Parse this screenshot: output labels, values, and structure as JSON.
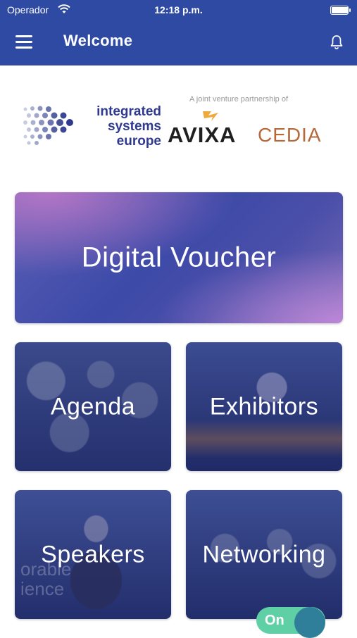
{
  "status_bar": {
    "carrier": "Operador",
    "time": "12:18 p.m.",
    "battery_level": 1.0
  },
  "header": {
    "title": "Welcome",
    "menu_icon": "hamburger-menu-icon",
    "notifications_icon": "bell-icon"
  },
  "logos": {
    "ise_lines": [
      "integrated",
      "systems",
      "europe"
    ],
    "partnership_text": "A joint venture partnership of",
    "avixa": "AVIXA",
    "cedia": "CEDIA"
  },
  "cards": {
    "voucher": "Digital Voucher",
    "agenda": "Agenda",
    "exhibitors": "Exhibitors",
    "speakers": "Speakers",
    "networking": "Networking",
    "speakers_bg_lines": [
      "orable",
      "ience"
    ]
  },
  "toggle": {
    "label": "On"
  },
  "colors": {
    "header": "#2f4aa3",
    "ise_blue": "#2f3a8f",
    "cedia": "#b5683a",
    "toggle_green": "#5fd0a6"
  }
}
